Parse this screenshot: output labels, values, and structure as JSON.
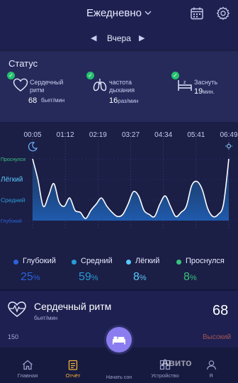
{
  "header": {
    "title": "Ежедневно",
    "day_label": "Вчера",
    "prev_symbol": "◀",
    "next_symbol": "▶",
    "icons": [
      "calendar-icon",
      "gear-icon"
    ]
  },
  "status": {
    "title": "Статус",
    "heart": {
      "label": "Сердечный ритм",
      "value": "68",
      "unit": "бьет/мин"
    },
    "breath": {
      "label": "частота дыхания",
      "value": "16",
      "unit": "раз/мин"
    },
    "sleep": {
      "label": "Заснуть",
      "value": "19",
      "unit": "мин."
    }
  },
  "chart_data": {
    "type": "area",
    "x_labels": [
      "00:05",
      "01:12",
      "02:19",
      "03:27",
      "04:34",
      "05:41",
      "06:49"
    ],
    "stages": [
      "Проснулся",
      "Лёгкий",
      "Средний",
      "Глубокий"
    ],
    "stage_colors": [
      "#39c37d",
      "#5ac8fa",
      "#2a9bd7",
      "#2b63d9"
    ],
    "series": [
      {
        "values": [
          0.0,
          1.0,
          2.3,
          1.8,
          1.2,
          2.1,
          2.3,
          1.9,
          2.5,
          2.6,
          2.9,
          2.5,
          2.2,
          1.9,
          2.3,
          2.6,
          2.8,
          2.7,
          2.2,
          1.6,
          1.8,
          2.5,
          2.7,
          2.8,
          2.2,
          1.8,
          2.3,
          2.8,
          2.6,
          2.3,
          1.3,
          1.1,
          1.5,
          2.4,
          2.8,
          2.7,
          2.2,
          0.0
        ]
      }
    ]
  },
  "legend": [
    {
      "name": "Глубокий",
      "value": "25",
      "pct": "%",
      "color": "#2b63d9"
    },
    {
      "name": "Средний",
      "value": "59",
      "pct": "%",
      "color": "#2a9bd7"
    },
    {
      "name": "Лёгкий",
      "value": "8",
      "pct": "%",
      "color": "#5ac8fa"
    },
    {
      "name": "Проснулся",
      "value": "8",
      "pct": "%",
      "color": "#39c37d"
    }
  ],
  "heart_rate": {
    "title": "Сердечный ритм",
    "unit": "бьет/мин",
    "value": "68",
    "axis_top": "150",
    "high_label": "Высокий"
  },
  "nav": {
    "home": "Главная",
    "report": "Отчёт",
    "sleep": "Начать сон",
    "device": "Устройство",
    "me": "Я"
  },
  "watermark": "Авито"
}
